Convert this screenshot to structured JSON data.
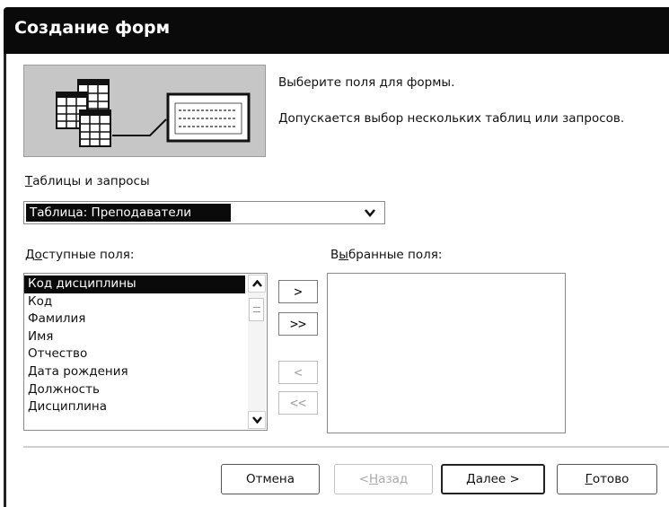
{
  "window": {
    "title": "Создание форм"
  },
  "header": {
    "line1": "Выберите поля для формы.",
    "line2": "Допускается выбор нескольких таблиц или запросов."
  },
  "source": {
    "label_mnemonic": "Т",
    "label_rest": "аблицы и запросы",
    "selected_value": "Таблица: Преподаватели"
  },
  "available": {
    "label_pre": "Д",
    "label_mnemonic": "о",
    "label_rest": "ступные поля:",
    "items": [
      "Код дисциплины",
      "Код",
      "Фамилия",
      "Имя",
      "Отчество",
      "Дата рождения",
      "Должность",
      "Дисциплина"
    ],
    "selected_index": 0
  },
  "selected": {
    "label_pre": "В",
    "label_mnemonic": "ы",
    "label_rest": "бранные поля:",
    "items": []
  },
  "move_buttons": {
    "add_one": ">",
    "add_all": ">>",
    "remove_one": "<",
    "remove_all": "<<"
  },
  "footer": {
    "cancel": "Отмена",
    "back_prefix": "< ",
    "back_mnemonic": "Н",
    "back_rest": "азад",
    "next_mnemonic": "Д",
    "next_rest": "алее >",
    "finish_mnemonic": "Г",
    "finish_rest": "отово"
  },
  "colors": {
    "titlebar": "#0a0a0a",
    "selection": "#0a0a0a",
    "illustration_bg": "#c6c6c6"
  },
  "icons": {
    "illustration": "tables-to-form-icon",
    "combo_arrow": "chevron-down-icon",
    "scroll_up": "chevron-up-icon",
    "scroll_down": "chevron-down-icon"
  }
}
